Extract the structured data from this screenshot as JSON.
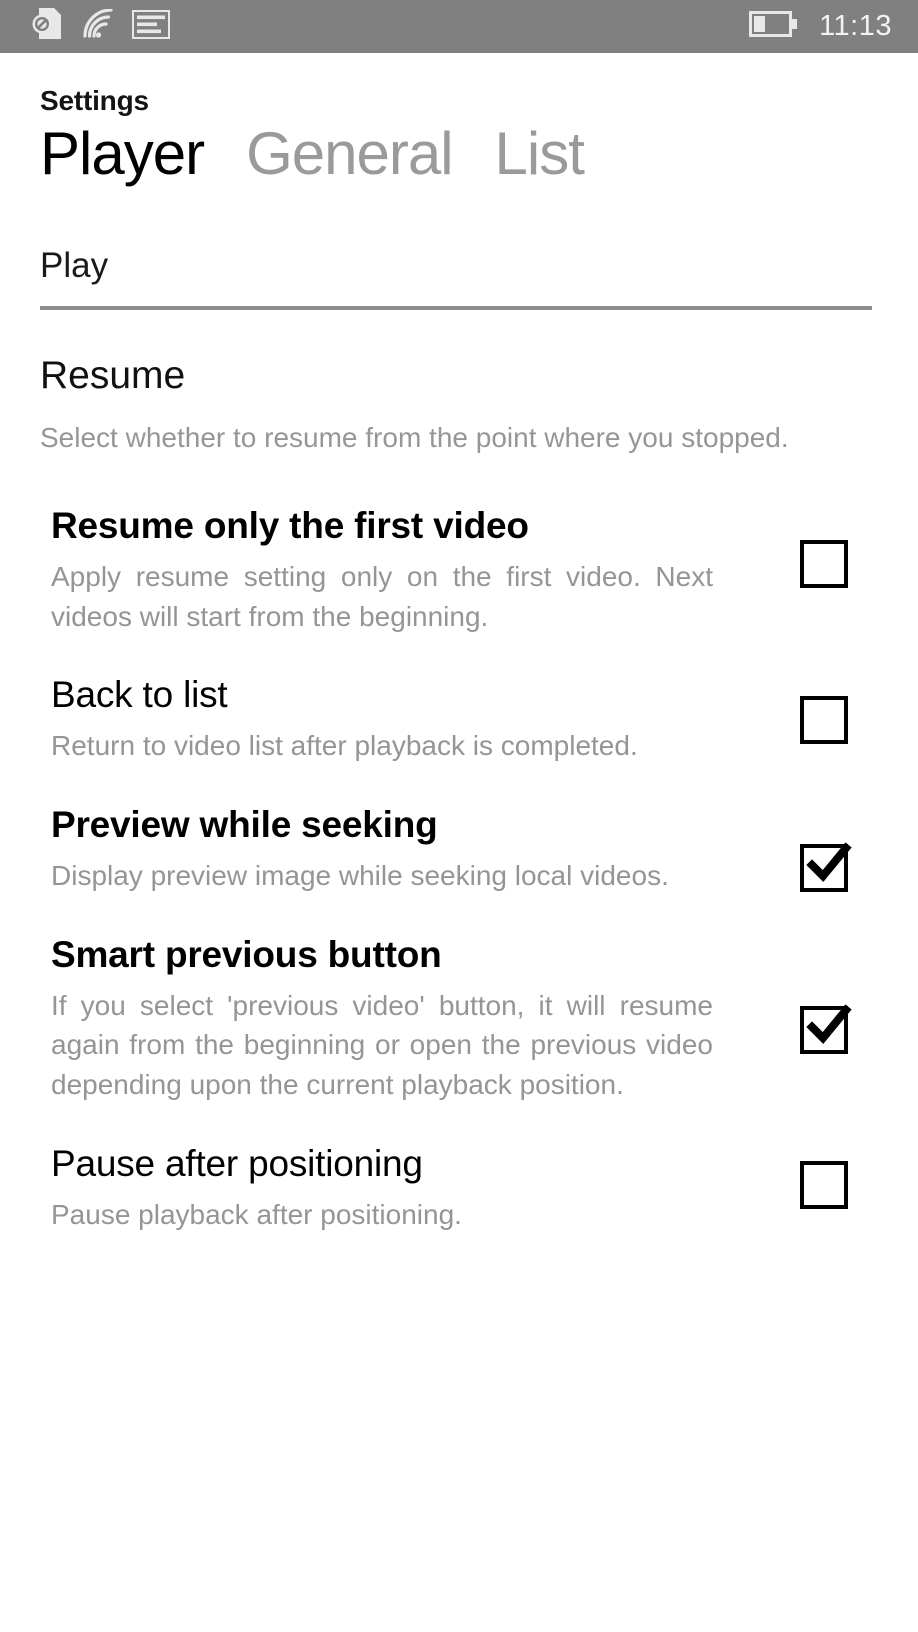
{
  "status_bar": {
    "icons": [
      "sim-card-blocked-icon",
      "wifi-icon",
      "message-icon"
    ],
    "battery_level_percent": 35,
    "battery_icon": "battery-icon",
    "time": "11:13",
    "background_color": "#808080",
    "foreground_color": "#f2f2f2"
  },
  "header": {
    "app_title": "Settings",
    "tabs": [
      {
        "label": "Player",
        "active": true
      },
      {
        "label": "General",
        "active": false
      },
      {
        "label": "List",
        "active": false
      }
    ]
  },
  "content": {
    "section_label": "Play",
    "group": {
      "title": "Resume",
      "description": "Select whether to resume from the point where you stopped."
    },
    "settings": [
      {
        "title": "Resume only the first video",
        "title_bold": true,
        "description": "Apply resume setting only on the first video. Next videos will start from the beginning.",
        "checked": false,
        "checkbox_name": "checkbox-resume-only-first-video"
      },
      {
        "title": "Back to list",
        "title_bold": false,
        "description": "Return to video list after playback is completed.",
        "checked": false,
        "checkbox_name": "checkbox-back-to-list"
      },
      {
        "title": "Preview while seeking",
        "title_bold": true,
        "description": "Display preview image while seeking local videos.",
        "checked": true,
        "checkbox_name": "checkbox-preview-while-seeking"
      },
      {
        "title": "Smart previous button",
        "title_bold": true,
        "description": "If you select 'previous video' button, it will resume again from the beginning or open the previous video depending upon the current playback position.",
        "checked": true,
        "checkbox_name": "checkbox-smart-previous-button"
      },
      {
        "title": "Pause after positioning",
        "title_bold": false,
        "description": "Pause playback after positioning.",
        "checked": false,
        "checkbox_name": "checkbox-pause-after-positioning"
      }
    ]
  },
  "colors": {
    "accent_text": "#000000",
    "muted_text": "#959595",
    "status_bar": "#808080",
    "rule": "#8e8e8e",
    "page_background": "#ffffff"
  }
}
